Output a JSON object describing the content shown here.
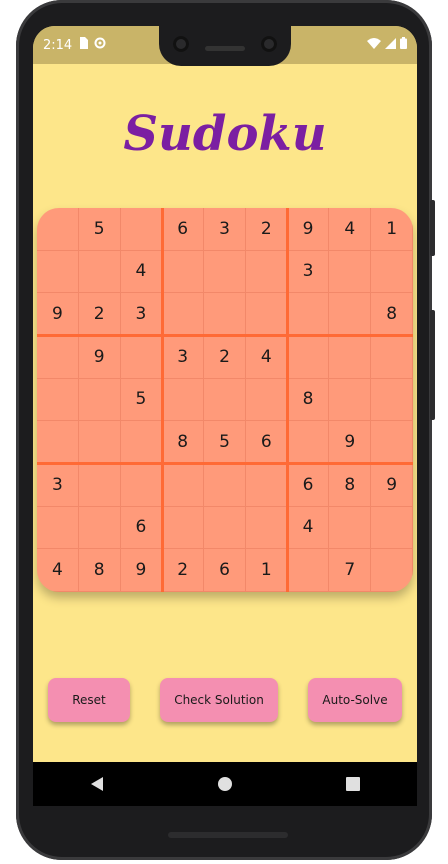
{
  "status_bar": {
    "time": "2:14"
  },
  "app": {
    "title": "Sudoku"
  },
  "board": {
    "rows": [
      [
        "",
        "5",
        "",
        "6",
        "3",
        "2",
        "9",
        "4",
        "1"
      ],
      [
        "",
        "",
        "4",
        "",
        "",
        "",
        "3",
        "",
        ""
      ],
      [
        "9",
        "2",
        "3",
        "",
        "",
        "",
        "",
        "",
        "8"
      ],
      [
        "",
        "9",
        "",
        "3",
        "2",
        "4",
        "",
        "",
        ""
      ],
      [
        "",
        "",
        "5",
        "",
        "",
        "",
        "8",
        "",
        ""
      ],
      [
        "",
        "",
        "",
        "8",
        "5",
        "6",
        "",
        "9",
        ""
      ],
      [
        "3",
        "",
        "",
        "",
        "",
        "",
        "6",
        "8",
        "9"
      ],
      [
        "",
        "",
        "6",
        "",
        "",
        "",
        "4",
        "",
        ""
      ],
      [
        "4",
        "8",
        "9",
        "2",
        "6",
        "1",
        "",
        "7",
        ""
      ]
    ]
  },
  "buttons": {
    "reset": "Reset",
    "check": "Check Solution",
    "solve": "Auto-Solve"
  },
  "colors": {
    "background": "#fde68a",
    "title": "#7b1fa2",
    "board": "#ff9a7a",
    "block_lines": "#ff6a35",
    "button": "#f48fb1"
  },
  "icons": {
    "status_left": [
      "sim-card-icon",
      "sync-icon"
    ],
    "status_right": [
      "wifi-icon",
      "signal-icon",
      "battery-icon"
    ],
    "navigation": [
      "back-icon",
      "home-icon",
      "recents-icon"
    ]
  }
}
